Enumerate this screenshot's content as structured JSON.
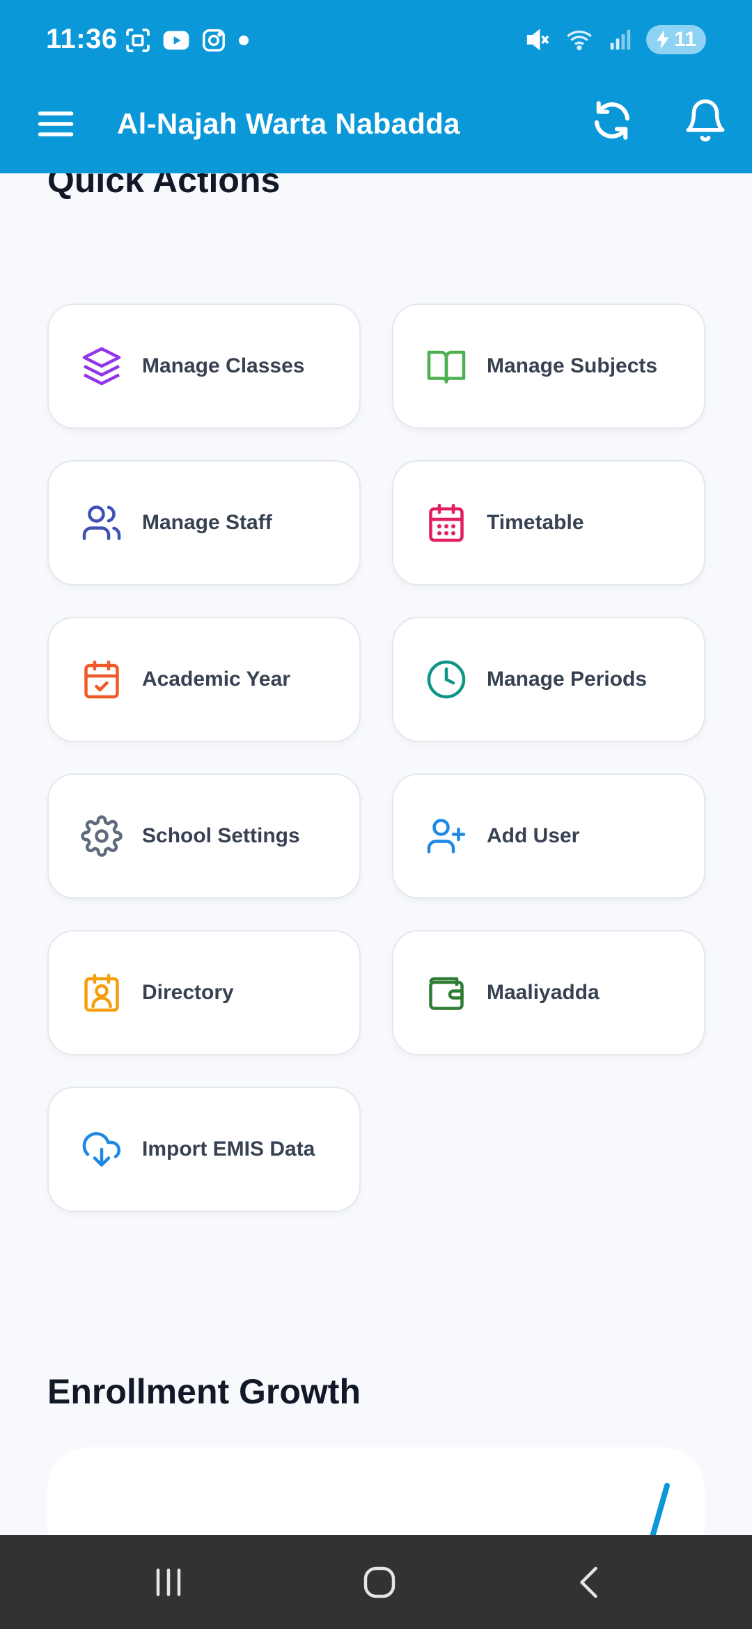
{
  "status": {
    "time": "11:36",
    "battery": "11"
  },
  "appbar": {
    "title": "Al-Najah Warta Nabadda"
  },
  "quick_actions": {
    "title": "Quick Actions",
    "items": [
      {
        "label": "Manage Classes",
        "icon": "layers-icon",
        "color": "#9333ea"
      },
      {
        "label": "Manage Subjects",
        "icon": "book-open-icon",
        "color": "#4caf50"
      },
      {
        "label": "Manage Staff",
        "icon": "users-icon",
        "color": "#3f51b5"
      },
      {
        "label": "Timetable",
        "icon": "calendar-icon",
        "color": "#e11d63"
      },
      {
        "label": "Academic Year",
        "icon": "calendar-check-icon",
        "color": "#f05a28"
      },
      {
        "label": "Manage Periods",
        "icon": "clock-icon",
        "color": "#0f9488"
      },
      {
        "label": "School Settings",
        "icon": "gear-icon",
        "color": "#5f6b7a"
      },
      {
        "label": "Add User",
        "icon": "user-plus-icon",
        "color": "#1e88e5"
      },
      {
        "label": "Directory",
        "icon": "contact-icon",
        "color": "#f59e0b"
      },
      {
        "label": "Maaliyadda",
        "icon": "wallet-icon",
        "color": "#2e7d32"
      },
      {
        "label": "Import EMIS Data",
        "icon": "cloud-download-icon",
        "color": "#1e88e5"
      }
    ]
  },
  "enrollment": {
    "title": "Enrollment Growth",
    "line_color": "#0a98d9"
  },
  "colors": {
    "primary": "#0a98d9",
    "background": "#f7f9fc"
  }
}
